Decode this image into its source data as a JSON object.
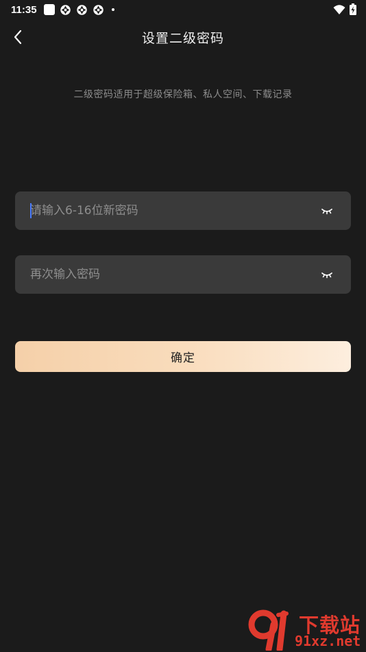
{
  "status_bar": {
    "time": "11:35",
    "icons": [
      "notification-square-icon",
      "app-ring-icon",
      "app-ring-icon",
      "app-ring-icon",
      "dot-icon"
    ],
    "right_icons": [
      "wifi-icon",
      "battery-charging-icon"
    ]
  },
  "header": {
    "back_icon": "chevron-left-icon",
    "title": "设置二级密码"
  },
  "description": "二级密码适用于超级保险箱、私人空间、下载记录",
  "form": {
    "new_password": {
      "value": "",
      "placeholder": "请输入6-16位新密码",
      "eye_icon": "eye-closed-icon"
    },
    "confirm_password": {
      "value": "",
      "placeholder": "再次输入密码",
      "eye_icon": "eye-closed-icon"
    },
    "confirm_label": "确定"
  },
  "watermark": {
    "line1": "下载站",
    "line2": "91xz.net"
  },
  "colors": {
    "background": "#1b1b1b",
    "field_background": "#3a3a3a",
    "button_gradient_start": "#f5d0a9",
    "button_gradient_end": "#fdeede",
    "watermark_red": "#e03a2e",
    "caret": "#4a7cff"
  }
}
